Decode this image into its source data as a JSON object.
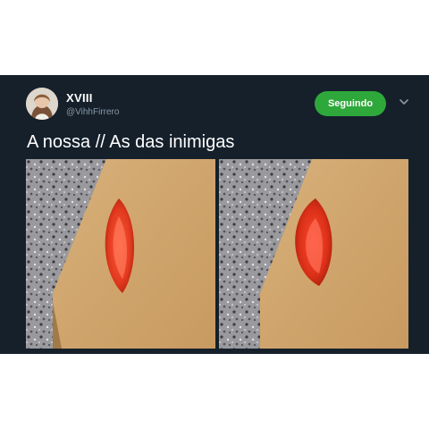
{
  "tweet": {
    "display_name": "XVIII",
    "handle": "@VihhFirrero",
    "follow_button_label": "Seguindo",
    "text": "A nossa // As das inimigas",
    "icons": {
      "avatar": "profile-photo",
      "more": "chevron-down-icon"
    }
  },
  "colors": {
    "tweet_background": "#15202b",
    "follow_button": "#2ea83a",
    "secondary_text": "#8899a6"
  }
}
